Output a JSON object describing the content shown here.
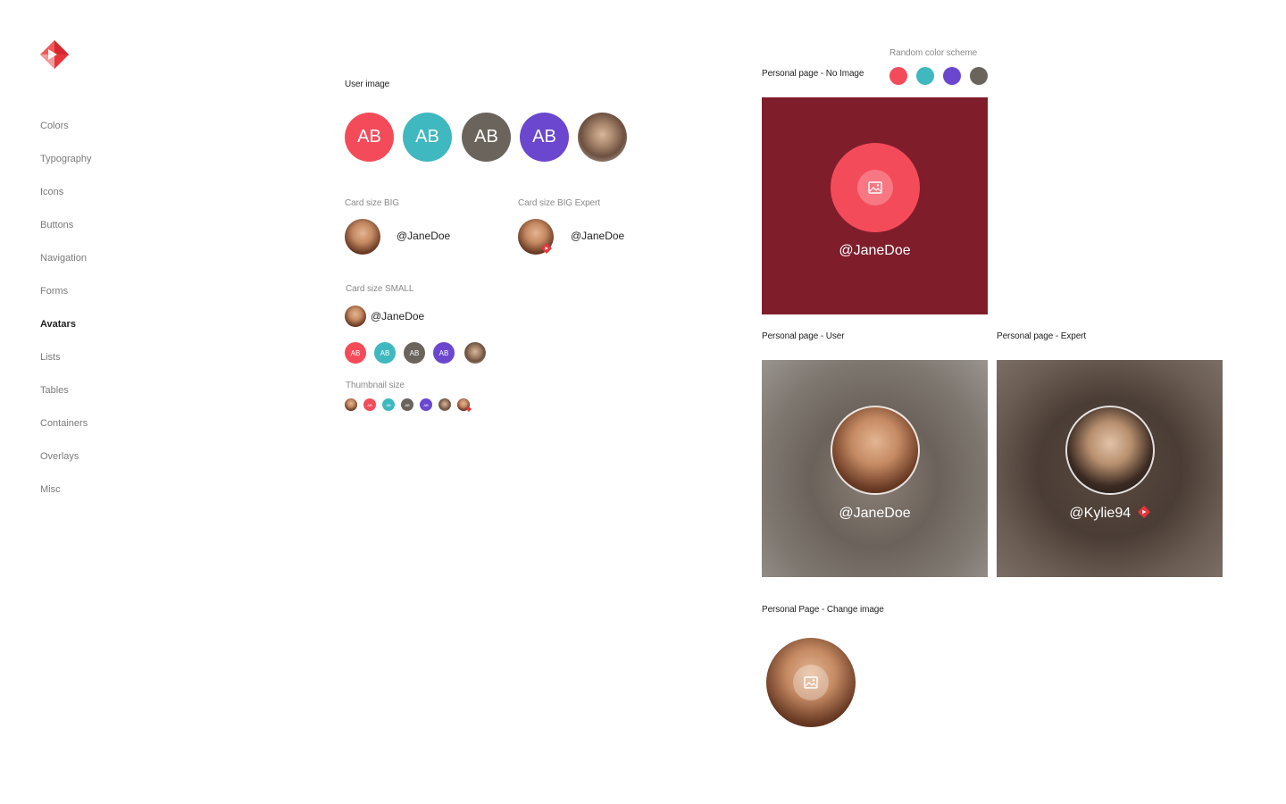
{
  "nav": {
    "items": [
      "Colors",
      "Typography",
      "Icons",
      "Buttons",
      "Navigation",
      "Forms",
      "Avatars",
      "Lists",
      "Tables",
      "Containers",
      "Overlays",
      "Misc"
    ],
    "active": "Avatars"
  },
  "user_image": {
    "label": "User image",
    "initials": "AB"
  },
  "card_big": {
    "label": "Card size BIG",
    "handle": "@JaneDoe"
  },
  "card_big_expert": {
    "label": "Card size BIG Expert",
    "handle": "@JaneDoe"
  },
  "card_small": {
    "label": "Card size SMALL",
    "handle": "@JaneDoe",
    "initials": "AB"
  },
  "thumbnail": {
    "label": "Thumbnail size",
    "initials": "AB"
  },
  "personal_no_image": {
    "label": "Personal page - No Image",
    "handle": "@JaneDoe",
    "bg_color": "#7f1d2b",
    "circle_color": "#f44b5a"
  },
  "random_scheme": {
    "label": "Random color scheme",
    "colors": [
      "#f44b5a",
      "#3fb8bf",
      "#6b47cf",
      "#6a645c"
    ]
  },
  "personal_user": {
    "label": "Personal page - User",
    "handle": "@JaneDoe"
  },
  "personal_expert": {
    "label": "Personal page - Expert",
    "handle": "@Kylie94"
  },
  "personal_change": {
    "label": "Personal Page - Change image"
  },
  "colors": {
    "red": "#f44b5a",
    "teal": "#3fb8bf",
    "gray": "#6a645c",
    "purple": "#6b47cf",
    "brand": "#e8343c"
  }
}
